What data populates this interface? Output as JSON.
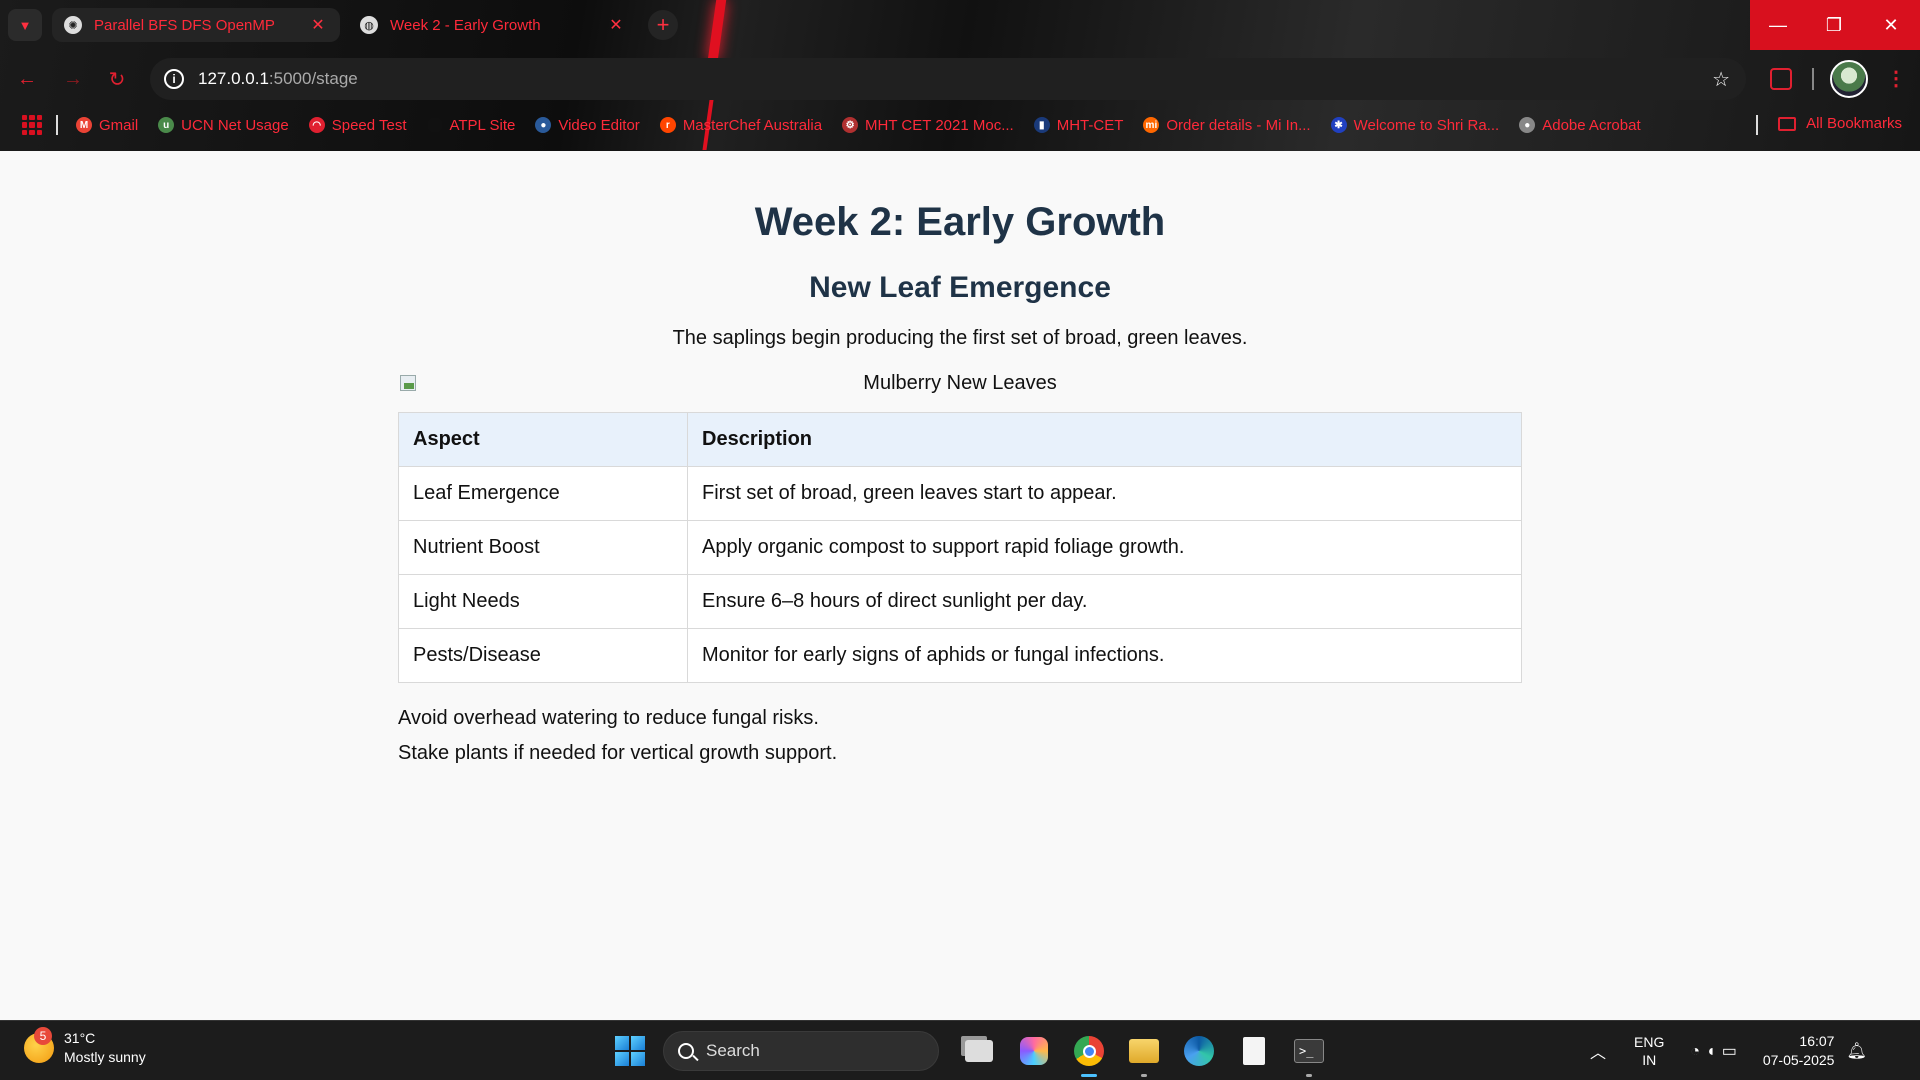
{
  "browser": {
    "tabs": [
      {
        "title": "Parallel BFS DFS OpenMP",
        "favicon": "openai-icon",
        "active": false
      },
      {
        "title": "Week 2 - Early Growth",
        "favicon": "globe-icon",
        "active": true
      }
    ],
    "new_tab": "+",
    "address": {
      "host": "127.0.0.1",
      "path": ":5000/stage"
    },
    "bookmarks": [
      {
        "label": "Gmail",
        "icon": "gmail-icon",
        "color": "#ea4335",
        "glyph": "M"
      },
      {
        "label": "UCN Net Usage",
        "icon": "ucn-icon",
        "color": "#4a8a4a",
        "glyph": "u"
      },
      {
        "label": "Speed Test",
        "icon": "speedometer-icon",
        "color": "#e02030",
        "glyph": "◠"
      },
      {
        "label": "ATPL Site",
        "icon": "atpl-icon",
        "color": "#111111",
        "glyph": ""
      },
      {
        "label": "Video Editor",
        "icon": "video-editor-icon",
        "color": "#2a5a9a",
        "glyph": "●"
      },
      {
        "label": "MasterChef Australia",
        "icon": "reddit-icon",
        "color": "#ff4500",
        "glyph": "r"
      },
      {
        "label": "MHT CET 2021 Moc...",
        "icon": "mht-icon",
        "color": "#b03030",
        "glyph": "⚙"
      },
      {
        "label": "MHT-CET",
        "icon": "mhtcet-icon",
        "color": "#1a3a7a",
        "glyph": "▮"
      },
      {
        "label": "Order details - Mi In...",
        "icon": "mi-icon",
        "color": "#ff6700",
        "glyph": "mi"
      },
      {
        "label": "Welcome to Shri Ra...",
        "icon": "shri-icon",
        "color": "#2040c0",
        "glyph": "✱"
      },
      {
        "label": "Adobe Acrobat",
        "icon": "globe-icon",
        "color": "#888888",
        "glyph": "●"
      }
    ],
    "all_bookmarks": "All Bookmarks",
    "accent": "#e01020"
  },
  "page": {
    "title": "Week 2: Early Growth",
    "subtitle": "New Leaf Emergence",
    "lead": "The saplings begin producing the first set of broad, green leaves.",
    "image_alt": "Mulberry New Leaves",
    "table": {
      "headers": [
        "Aspect",
        "Description"
      ],
      "rows": [
        [
          "Leaf Emergence",
          "First set of broad, green leaves start to appear."
        ],
        [
          "Nutrient Boost",
          "Apply organic compost to support rapid foliage growth."
        ],
        [
          "Light Needs",
          "Ensure 6–8 hours of direct sunlight per day."
        ],
        [
          "Pests/Disease",
          "Monitor for early signs of aphids or fungal infections."
        ]
      ]
    },
    "notes": [
      "Avoid overhead watering to reduce fungal risks.",
      "Stake plants if needed for vertical growth support."
    ],
    "heading_color": "#1f3347",
    "header_bg": "#e8f1fb"
  },
  "taskbar": {
    "weather": {
      "badge": "5",
      "temp": "31°C",
      "condition": "Mostly sunny"
    },
    "search_label": "Search",
    "lang": {
      "top": "ENG",
      "bottom": "IN"
    },
    "time": "16:07",
    "date": "07-05-2025"
  }
}
